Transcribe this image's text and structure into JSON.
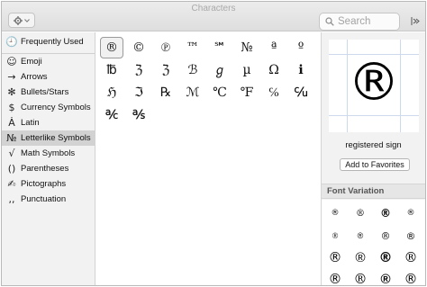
{
  "window": {
    "title": "Characters"
  },
  "toolbar": {
    "action_icon": "gear-icon",
    "search_placeholder": "Search",
    "search_icon": "magnifier-icon",
    "collapse_icon": "collapse-panel-icon"
  },
  "sidebar": {
    "items": [
      {
        "glyph": "🕘",
        "label": "Frequently Used",
        "icon": "clock-icon",
        "selected": false
      },
      {
        "glyph": "☺",
        "label": "Emoji",
        "icon": "smiley-icon",
        "selected": false
      },
      {
        "glyph": "→",
        "label": "Arrows",
        "icon": "arrow-icon",
        "selected": false
      },
      {
        "glyph": "✻",
        "label": "Bullets/Stars",
        "icon": "star-icon",
        "selected": false
      },
      {
        "glyph": "$",
        "label": "Currency Symbols",
        "icon": "dollar-icon",
        "selected": false
      },
      {
        "glyph": "Ȧ",
        "label": "Latin",
        "icon": "latin-letter-icon",
        "selected": false
      },
      {
        "glyph": "№",
        "label": "Letterlike Symbols",
        "icon": "numero-icon",
        "selected": true
      },
      {
        "glyph": "√",
        "label": "Math Symbols",
        "icon": "square-root-icon",
        "selected": false
      },
      {
        "glyph": "()",
        "label": "Parentheses",
        "icon": "parentheses-icon",
        "selected": false
      },
      {
        "glyph": "✍",
        "label": "Pictographs",
        "icon": "pictograph-icon",
        "selected": false
      },
      {
        "glyph": ",,",
        "label": "Punctuation",
        "icon": "punctuation-icon",
        "selected": false
      }
    ]
  },
  "characters": {
    "rows": [
      [
        "®",
        "©",
        "℗",
        "™",
        "℠",
        "№",
        "ª",
        "º"
      ],
      [
        "℔",
        "ℨ",
        "ℨ",
        "ℬ",
        "ℊ",
        "µ",
        "Ω",
        "ℹ"
      ],
      [
        "ℌ",
        "ℑ",
        "℞",
        "ℳ",
        "℃",
        "℉",
        "℅",
        "℆"
      ],
      [
        "℀",
        "℁"
      ]
    ],
    "selected": "®"
  },
  "detail": {
    "glyph": "®",
    "name": "registered sign",
    "favorite_button": "Add to Favorites"
  },
  "font_variation": {
    "title": "Font Variation",
    "glyphs": [
      "®",
      "®",
      "®",
      "®",
      "®",
      "®",
      "®",
      "®",
      "®",
      "®",
      "®",
      "®",
      "®",
      "®",
      "®",
      "®"
    ]
  }
}
